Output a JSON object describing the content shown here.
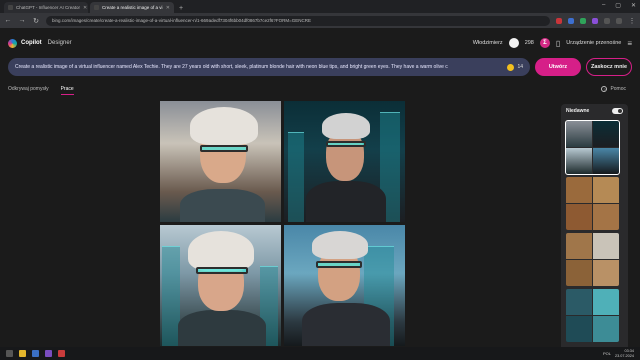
{
  "browser": {
    "tabs": [
      {
        "title": "ChatGPT - Influencer AI Creator",
        "active": false
      },
      {
        "title": "Create a realistic image of a vi",
        "active": true
      }
    ],
    "new_tab": "+",
    "window_controls": [
      "–",
      "▢",
      "✕"
    ],
    "url": "bing.com/images/create/create-a-realistic-image-of-a-virtual-influencer-n/1-669adedf7304f6bb04df0867b7ce2f6?FORM=GENCRE",
    "nav": {
      "back": "←",
      "forward": "→",
      "reload": "↻"
    }
  },
  "header": {
    "brand": "Copilot",
    "product": "Designer",
    "user_name": "Włodzimierz",
    "points": "298",
    "coin_label": "Σ",
    "devices_label": "Urządzenie przenośne"
  },
  "prompt": {
    "text": "Create a realistic image of a virtual influencer named Alex Techie. They are 27 years old with short, sleek, platinum blonde hair with neon blue tips, and bright green eyes. They have a warm olive c",
    "boosts": "14",
    "create_label": "Utwórz",
    "join_label": "Zaskocz mnie"
  },
  "subnav": {
    "explore": "Odkrywaj pomysły",
    "creations": "Prace"
  },
  "help_label": "Pomoc",
  "sidebar": {
    "title": "Niedawne"
  },
  "taskbar": {
    "lang": "POL",
    "time": "03:34",
    "date": "23.07.2024"
  },
  "colors": {
    "accent": "#d61f88",
    "prompt_bg": "#3a3f5c",
    "page_bg": "#1b1b1b"
  }
}
